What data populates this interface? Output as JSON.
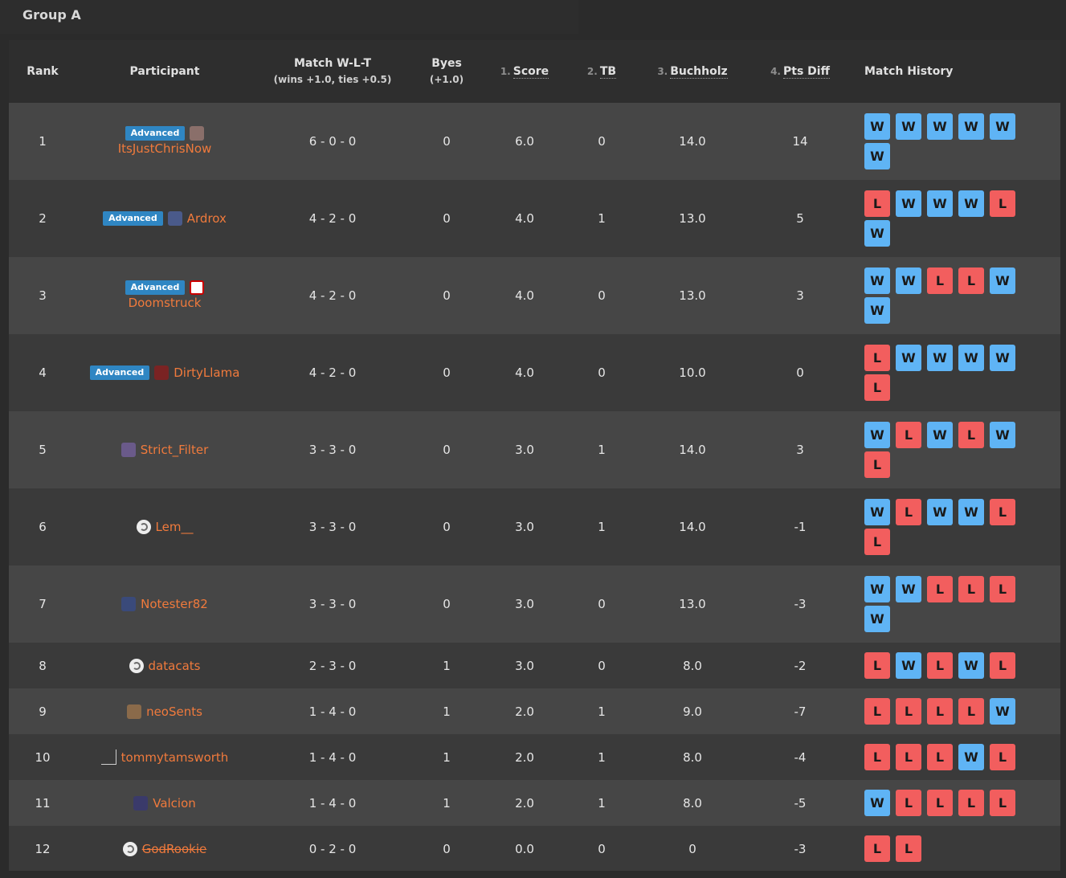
{
  "group": {
    "title": "Group A"
  },
  "headers": {
    "rank": "Rank",
    "participant": "Participant",
    "match_wlt": "Match W-L-T",
    "match_wlt_sub": "(wins +1.0, ties +0.5)",
    "byes": "Byes",
    "byes_sub": "(+1.0)",
    "score_num": "1.",
    "score": "Score",
    "tb_num": "2.",
    "tb": "TB",
    "buchholz_num": "3.",
    "buchholz": "Buchholz",
    "ptsdiff_num": "4.",
    "ptsdiff": "Pts Diff",
    "history": "Match History"
  },
  "colors": {
    "win": "#5fb4f5",
    "loss": "#f25e5e",
    "accent": "#f07a3c",
    "badge": "#2f86c3"
  },
  "rows": [
    {
      "rank": "1",
      "badge": "Advanced",
      "name": "ItsJustChrisNow",
      "avatar": "photo-avatar",
      "layout": "stacked",
      "wlt": "6 - 0 - 0",
      "byes": "0",
      "score": "6.0",
      "tb": "0",
      "buchholz": "14.0",
      "diff": "14",
      "history": [
        "W",
        "W",
        "W",
        "W",
        "W",
        "W"
      ]
    },
    {
      "rank": "2",
      "badge": "Advanced",
      "name": "Ardrox",
      "avatar": "photo-avatar",
      "layout": "inline",
      "wlt": "4 - 2 - 0",
      "byes": "0",
      "score": "4.0",
      "tb": "1",
      "buchholz": "13.0",
      "diff": "5",
      "history": [
        "L",
        "W",
        "W",
        "W",
        "L",
        "W"
      ]
    },
    {
      "rank": "3",
      "badge": "Advanced",
      "name": "Doomstruck",
      "avatar": "photo-avatar",
      "layout": "stacked",
      "wlt": "4 - 2 - 0",
      "byes": "0",
      "score": "4.0",
      "tb": "0",
      "buchholz": "13.0",
      "diff": "3",
      "history": [
        "W",
        "W",
        "L",
        "L",
        "W",
        "W"
      ]
    },
    {
      "rank": "4",
      "badge": "Advanced",
      "name": "DirtyLlama",
      "avatar": "photo-avatar",
      "layout": "inline",
      "wlt": "4 - 2 - 0",
      "byes": "0",
      "score": "4.0",
      "tb": "0",
      "buchholz": "10.0",
      "diff": "0",
      "history": [
        "L",
        "W",
        "W",
        "W",
        "W",
        "L"
      ]
    },
    {
      "rank": "5",
      "badge": "",
      "name": "Strict_Filter",
      "avatar": "photo-avatar",
      "layout": "inline",
      "wlt": "3 - 3 - 0",
      "byes": "0",
      "score": "3.0",
      "tb": "1",
      "buchholz": "14.0",
      "diff": "3",
      "history": [
        "W",
        "L",
        "W",
        "L",
        "W",
        "L"
      ]
    },
    {
      "rank": "6",
      "badge": "",
      "name": "Lem__",
      "avatar": "default-avatar",
      "layout": "inline",
      "wlt": "3 - 3 - 0",
      "byes": "0",
      "score": "3.0",
      "tb": "1",
      "buchholz": "14.0",
      "diff": "-1",
      "history": [
        "W",
        "L",
        "W",
        "W",
        "L",
        "L"
      ]
    },
    {
      "rank": "7",
      "badge": "",
      "name": "Notester82",
      "avatar": "photo-avatar",
      "layout": "inline",
      "wlt": "3 - 3 - 0",
      "byes": "0",
      "score": "3.0",
      "tb": "0",
      "buchholz": "13.0",
      "diff": "-3",
      "history": [
        "W",
        "W",
        "L",
        "L",
        "L",
        "W"
      ]
    },
    {
      "rank": "8",
      "badge": "",
      "name": "datacats",
      "avatar": "default-avatar",
      "layout": "inline",
      "wlt": "2 - 3 - 0",
      "byes": "1",
      "score": "3.0",
      "tb": "0",
      "buchholz": "8.0",
      "diff": "-2",
      "history": [
        "L",
        "W",
        "L",
        "W",
        "L"
      ]
    },
    {
      "rank": "9",
      "badge": "",
      "name": "neoSents",
      "avatar": "photo-avatar",
      "layout": "inline",
      "wlt": "1 - 4 - 0",
      "byes": "1",
      "score": "2.0",
      "tb": "1",
      "buchholz": "9.0",
      "diff": "-7",
      "history": [
        "L",
        "L",
        "L",
        "L",
        "W"
      ]
    },
    {
      "rank": "10",
      "badge": "",
      "name": "tommytamsworth",
      "avatar": "blank-avatar",
      "layout": "inline",
      "wlt": "1 - 4 - 0",
      "byes": "1",
      "score": "2.0",
      "tb": "1",
      "buchholz": "8.0",
      "diff": "-4",
      "history": [
        "L",
        "L",
        "L",
        "W",
        "L"
      ]
    },
    {
      "rank": "11",
      "badge": "",
      "name": "Valcion",
      "avatar": "photo-avatar",
      "layout": "inline",
      "wlt": "1 - 4 - 0",
      "byes": "1",
      "score": "2.0",
      "tb": "1",
      "buchholz": "8.0",
      "diff": "-5",
      "history": [
        "W",
        "L",
        "L",
        "L",
        "L"
      ]
    },
    {
      "rank": "12",
      "badge": "",
      "name": "GodRookie",
      "avatar": "default-avatar",
      "layout": "inline",
      "struck": true,
      "wlt": "0 - 2 - 0",
      "byes": "0",
      "score": "0.0",
      "tb": "0",
      "buchholz": "0",
      "diff": "-3",
      "history": [
        "L",
        "L"
      ]
    }
  ]
}
